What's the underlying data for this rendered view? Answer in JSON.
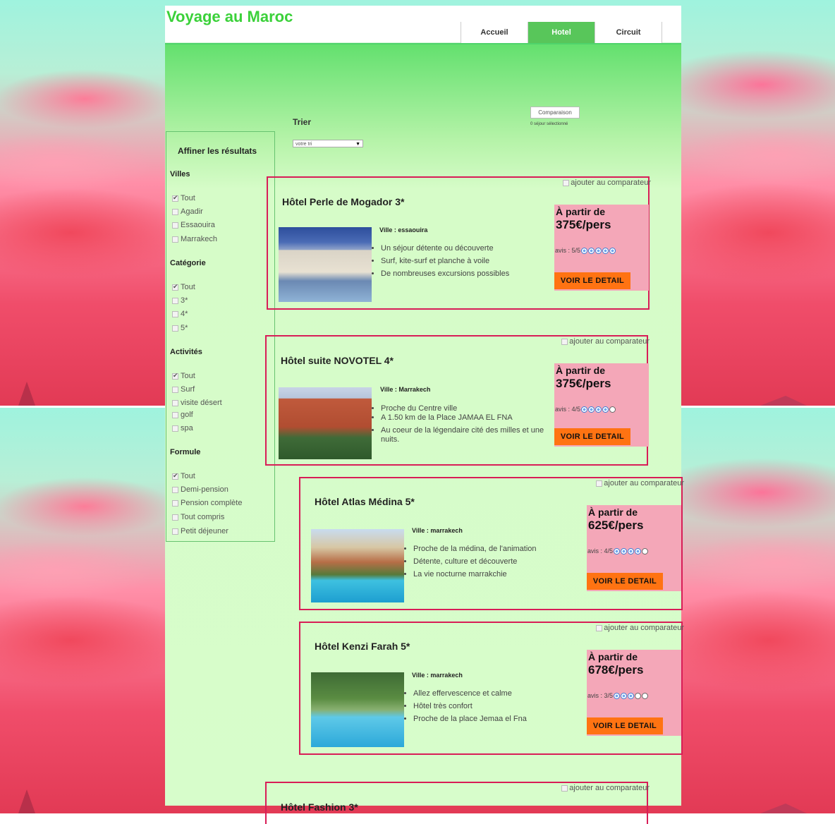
{
  "site_title": "Voyage au Maroc",
  "nav": [
    {
      "label": "Accueil",
      "active": false
    },
    {
      "label": "Hotel",
      "active": true
    },
    {
      "label": "Circuit",
      "active": false
    }
  ],
  "toolbar": {
    "compare_button": "Comparaison",
    "compare_count": "0 séjour sélectionné",
    "sort_label": "Trier",
    "sort_selected": "votre tri"
  },
  "sidebar": {
    "title": "Affiner les résultats",
    "villes": {
      "label": "Villes",
      "items": [
        {
          "label": "Tout",
          "checked": true
        },
        {
          "label": "Agadir",
          "checked": false
        },
        {
          "label": "Essaouira",
          "checked": false
        },
        {
          "label": "Marrakech",
          "checked": false
        }
      ]
    },
    "categorie": {
      "label": "Catégorie",
      "items": [
        {
          "label": "Tout",
          "checked": true
        },
        {
          "label": "3*",
          "checked": false
        },
        {
          "label": "4*",
          "checked": false
        },
        {
          "label": "5*",
          "checked": false
        }
      ]
    },
    "activites": {
      "label": "Activités",
      "items": [
        {
          "label": "Tout",
          "checked": true
        },
        {
          "label": "Surf",
          "checked": false
        },
        {
          "label": "visite désert",
          "checked": false
        },
        {
          "label": "golf",
          "checked": false
        },
        {
          "label": "spa",
          "checked": false
        }
      ]
    },
    "formule": {
      "label": "Formule",
      "items": [
        {
          "label": "Tout",
          "checked": true
        },
        {
          "label": "Demi-pension",
          "checked": false
        },
        {
          "label": "Pension complète",
          "checked": false
        },
        {
          "label": "Tout compris",
          "checked": false
        },
        {
          "label": "Petit déjeuner",
          "checked": false
        }
      ]
    }
  },
  "hotels": [
    {
      "name": "Hôtel Perle de Mogador 3*",
      "ville": "Ville : essaouira",
      "features": [
        "Un séjour détente ou découverte",
        "Surf, kite-surf et planche à voile",
        "De nombreuses excursions possibles"
      ],
      "compare_label": "ajouter au comparateur",
      "from_label": "À partir de",
      "price": "375€/pers",
      "avis": "avis : 5/5",
      "rating": 5,
      "detail_label": "VOIR LE DETAIL"
    },
    {
      "name": "Hôtel suite NOVOTEL 4*",
      "ville": "Ville : Marrakech",
      "features": [
        "Proche du Centre ville",
        "A 1.50 km de la Place JAMAA EL FNA",
        "Au coeur de la légendaire cité des milles et une nuits."
      ],
      "compare_label": "ajouter au comparateur",
      "from_label": "À partir de",
      "price": "375€/pers",
      "avis": "avis : 4/5",
      "rating": 4,
      "detail_label": "VOIR LE DETAIL"
    },
    {
      "name": "Hôtel Atlas Médina 5*",
      "ville": "Ville : marrakech",
      "features": [
        "Proche de la médina, de l'animation",
        "Détente, culture et découverte",
        "La vie nocturne marrakchie"
      ],
      "compare_label": "ajouter au comparateur",
      "from_label": "À partir de",
      "price": "625€/pers",
      "avis": "avis : 4/5",
      "rating": 4,
      "detail_label": "VOIR LE DETAIL"
    },
    {
      "name": "Hôtel Kenzi Farah 5*",
      "ville": "Ville : marrakech",
      "features": [
        "Allez effervescence et calme",
        "Hôtel très confort",
        "Proche de la place Jemaa el Fna"
      ],
      "compare_label": "ajouter au comparateur",
      "from_label": "À partir de",
      "price": "678€/pers",
      "avis": "avis : 3/5",
      "rating": 3,
      "detail_label": "VOIR LE DETAIL"
    },
    {
      "name": "Hôtel Fashion 3*",
      "compare_label": "ajouter au comparateur"
    }
  ]
}
